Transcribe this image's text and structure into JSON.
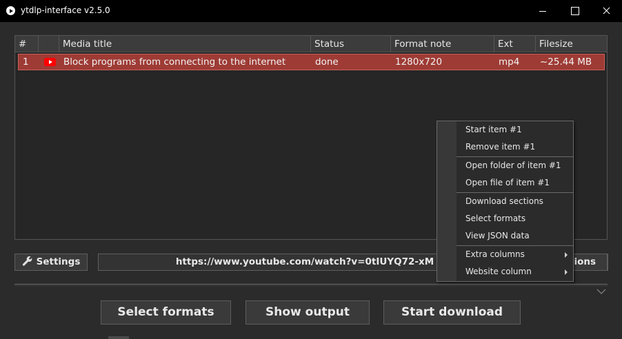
{
  "window": {
    "title": "ytdlp-interface v2.5.0"
  },
  "table": {
    "columns": [
      "#",
      "",
      "Media title",
      "Status",
      "Format note",
      "Ext",
      "Filesize"
    ],
    "rows": [
      {
        "num": "1",
        "icon": "youtube-icon",
        "title": "Block programs from connecting to the internet",
        "status": "done",
        "format_note": "1280x720",
        "ext": "mp4",
        "filesize": "~25.44 MB"
      }
    ]
  },
  "controls": {
    "settings_label": "Settings",
    "url": "https://www.youtube.com/watch?v=0tIUYQ72-xM",
    "options_label_visible": "tions"
  },
  "actions": {
    "select_formats": "Select formats",
    "show_output": "Show output",
    "start_download": "Start download"
  },
  "context_menu": {
    "start_item": "Start item #1",
    "remove_item": "Remove item #1",
    "open_folder": "Open folder of item #1",
    "open_file": "Open file of item #1",
    "download_sections": "Download sections",
    "select_formats": "Select formats",
    "view_json": "View JSON data",
    "extra_columns": "Extra columns",
    "website_column": "Website column"
  },
  "colors": {
    "selected_row": "#9e3b35",
    "youtube_red": "#ff0000",
    "background": "#2b2b2b"
  }
}
